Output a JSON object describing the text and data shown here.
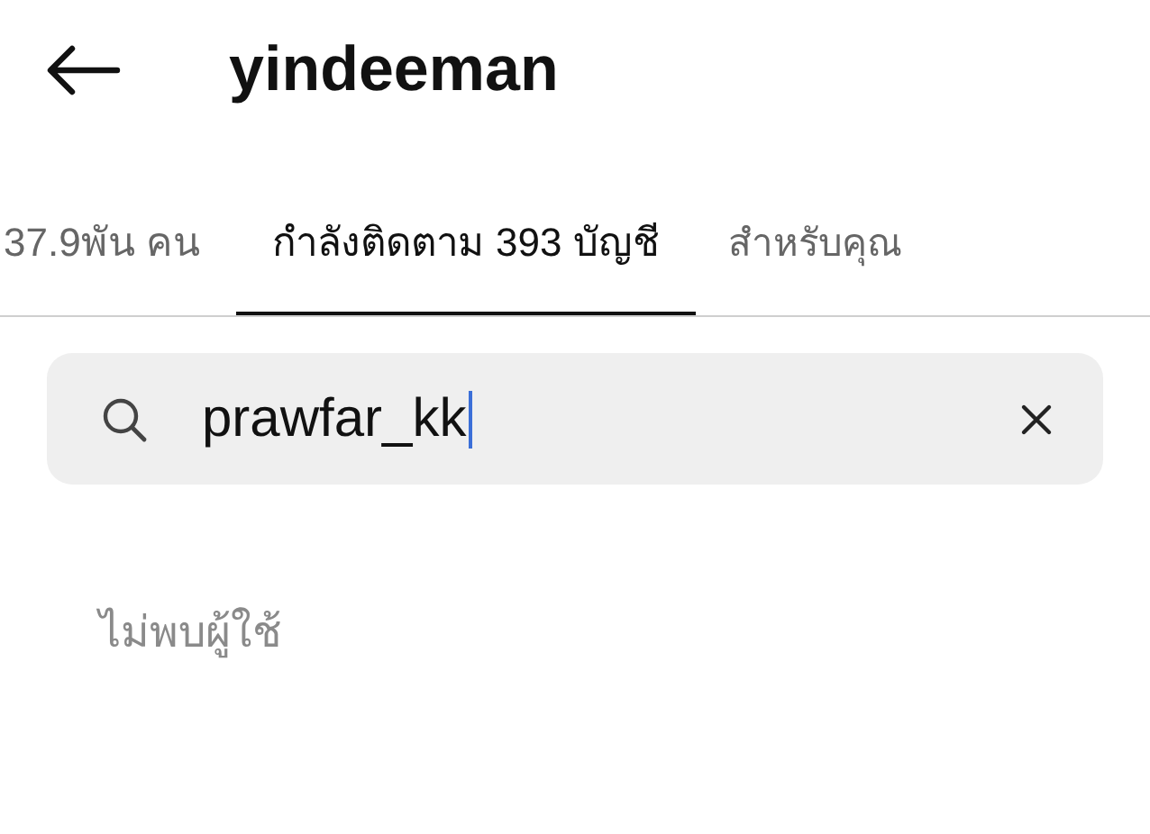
{
  "header": {
    "title": "yindeeman"
  },
  "tabs": [
    {
      "label": "37.9พัน คน",
      "selected": false
    },
    {
      "label": "กำลังติดตาม 393 บัญชี",
      "selected": true
    },
    {
      "label": "สำหรับคุณ",
      "selected": false
    }
  ],
  "search": {
    "value": "prawfar_kk",
    "focused": true
  },
  "empty_message": "ไม่พบผู้ใช้"
}
